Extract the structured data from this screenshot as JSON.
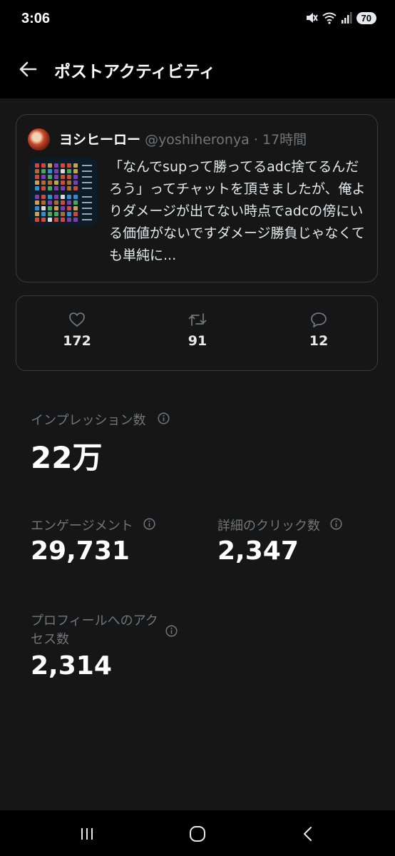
{
  "status_bar": {
    "time": "3:06",
    "battery": "70"
  },
  "header": {
    "title": "ポストアクティビティ"
  },
  "post": {
    "author_name": "ヨシヒーロー",
    "author_handle": "@yoshiheronya",
    "separator": " · ",
    "time_ago": "17時間",
    "text": "「なんでsupって勝ってるadc捨てるんだろう」ってチャットを頂きましたが、俺よりダメージが出てない時点でadcの傍にいる価値がないですダメージ勝負じゃなくても単純に..."
  },
  "engagement": {
    "likes": "172",
    "reposts": "91",
    "replies": "12"
  },
  "metrics": {
    "impressions": {
      "label": "インプレッション数",
      "value": "22万"
    },
    "engagements": {
      "label": "エンゲージメント",
      "value": "29,731"
    },
    "detail_clicks": {
      "label": "詳細のクリック数",
      "value": "2,347"
    },
    "profile_visits": {
      "label": "プロフィールへのアクセス数",
      "value": "2,314"
    }
  },
  "colors": {
    "background": "#161616",
    "bar_background": "#000000",
    "border": "#3b3b3b",
    "muted_text": "#71767b",
    "text": "#e7e9ea"
  },
  "icons": {
    "back": "arrow-left-icon",
    "like": "heart-icon",
    "repost": "repost-icon",
    "reply": "speech-bubble-icon",
    "info": "info-circle-icon",
    "nav_recents": "recents-icon",
    "nav_home": "home-icon",
    "nav_back": "chevron-left-icon"
  }
}
